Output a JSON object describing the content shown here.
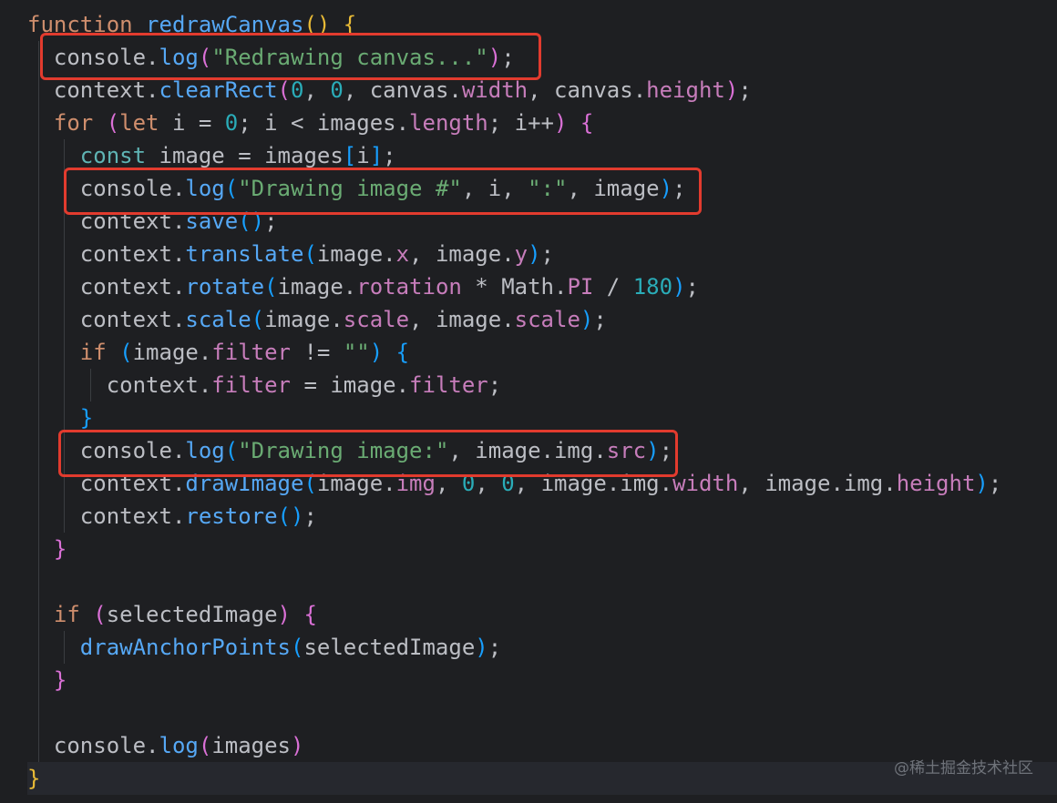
{
  "colors": {
    "background": "#1e1f22",
    "highlight_border": "#e23b2e",
    "keyword": "#cf8e6d",
    "function": "#56a8f5",
    "string": "#6aab73",
    "number": "#2aacb8",
    "property": "#c77dbb"
  },
  "editor": {
    "lines": [
      [
        {
          "t": "function ",
          "c": "c-kw"
        },
        {
          "t": "redrawCanvas",
          "c": "c-fn"
        },
        {
          "t": "() ",
          "c": "c-b1"
        },
        {
          "t": "{",
          "c": "c-b1"
        }
      ],
      [
        {
          "t": "  console.",
          "c": "c-def"
        },
        {
          "t": "log",
          "c": "c-fn"
        },
        {
          "t": "(",
          "c": "c-b2"
        },
        {
          "t": "\"Redrawing canvas...\"",
          "c": "c-str"
        },
        {
          "t": ")",
          "c": "c-b2"
        },
        {
          "t": ";",
          "c": "c-def"
        }
      ],
      [
        {
          "t": "  context.",
          "c": "c-def"
        },
        {
          "t": "clearRect",
          "c": "c-fn"
        },
        {
          "t": "(",
          "c": "c-b2"
        },
        {
          "t": "0",
          "c": "c-num"
        },
        {
          "t": ", ",
          "c": "c-def"
        },
        {
          "t": "0",
          "c": "c-num"
        },
        {
          "t": ", canvas.",
          "c": "c-def"
        },
        {
          "t": "width",
          "c": "c-prop"
        },
        {
          "t": ", canvas.",
          "c": "c-def"
        },
        {
          "t": "height",
          "c": "c-prop"
        },
        {
          "t": ")",
          "c": "c-b2"
        },
        {
          "t": ";",
          "c": "c-def"
        }
      ],
      [
        {
          "t": "  for ",
          "c": "c-kw"
        },
        {
          "t": "(",
          "c": "c-b2"
        },
        {
          "t": "let ",
          "c": "c-kw"
        },
        {
          "t": "i = ",
          "c": "c-def"
        },
        {
          "t": "0",
          "c": "c-num"
        },
        {
          "t": "; i < images.",
          "c": "c-def"
        },
        {
          "t": "length",
          "c": "c-prop"
        },
        {
          "t": "; i++",
          "c": "c-def"
        },
        {
          "t": ") ",
          "c": "c-b2"
        },
        {
          "t": "{",
          "c": "c-b2"
        }
      ],
      [
        {
          "t": "    const ",
          "c": "c-kw2"
        },
        {
          "t": "image = images",
          "c": "c-def"
        },
        {
          "t": "[",
          "c": "c-b3"
        },
        {
          "t": "i",
          "c": "c-def"
        },
        {
          "t": "]",
          "c": "c-b3"
        },
        {
          "t": ";",
          "c": "c-def"
        }
      ],
      [
        {
          "t": "    console.",
          "c": "c-def"
        },
        {
          "t": "log",
          "c": "c-fn"
        },
        {
          "t": "(",
          "c": "c-b3"
        },
        {
          "t": "\"Drawing image #\"",
          "c": "c-str"
        },
        {
          "t": ", i, ",
          "c": "c-def"
        },
        {
          "t": "\":\"",
          "c": "c-str"
        },
        {
          "t": ", image",
          "c": "c-def"
        },
        {
          "t": ")",
          "c": "c-b3"
        },
        {
          "t": ";",
          "c": "c-def"
        }
      ],
      [
        {
          "t": "    context.",
          "c": "c-def"
        },
        {
          "t": "save",
          "c": "c-fn"
        },
        {
          "t": "()",
          "c": "c-b3"
        },
        {
          "t": ";",
          "c": "c-def"
        }
      ],
      [
        {
          "t": "    context.",
          "c": "c-def"
        },
        {
          "t": "translate",
          "c": "c-fn"
        },
        {
          "t": "(",
          "c": "c-b3"
        },
        {
          "t": "image.",
          "c": "c-def"
        },
        {
          "t": "x",
          "c": "c-prop"
        },
        {
          "t": ", image.",
          "c": "c-def"
        },
        {
          "t": "y",
          "c": "c-prop"
        },
        {
          "t": ")",
          "c": "c-b3"
        },
        {
          "t": ";",
          "c": "c-def"
        }
      ],
      [
        {
          "t": "    context.",
          "c": "c-def"
        },
        {
          "t": "rotate",
          "c": "c-fn"
        },
        {
          "t": "(",
          "c": "c-b3"
        },
        {
          "t": "image.",
          "c": "c-def"
        },
        {
          "t": "rotation",
          "c": "c-prop"
        },
        {
          "t": " * Math.",
          "c": "c-def"
        },
        {
          "t": "PI",
          "c": "c-prop"
        },
        {
          "t": " / ",
          "c": "c-def"
        },
        {
          "t": "180",
          "c": "c-num"
        },
        {
          "t": ")",
          "c": "c-b3"
        },
        {
          "t": ";",
          "c": "c-def"
        }
      ],
      [
        {
          "t": "    context.",
          "c": "c-def"
        },
        {
          "t": "scale",
          "c": "c-fn"
        },
        {
          "t": "(",
          "c": "c-b3"
        },
        {
          "t": "image.",
          "c": "c-def"
        },
        {
          "t": "scale",
          "c": "c-prop"
        },
        {
          "t": ", image.",
          "c": "c-def"
        },
        {
          "t": "scale",
          "c": "c-prop"
        },
        {
          "t": ")",
          "c": "c-b3"
        },
        {
          "t": ";",
          "c": "c-def"
        }
      ],
      [
        {
          "t": "    if ",
          "c": "c-kw"
        },
        {
          "t": "(",
          "c": "c-b3"
        },
        {
          "t": "image.",
          "c": "c-def"
        },
        {
          "t": "filter",
          "c": "c-prop"
        },
        {
          "t": " != ",
          "c": "c-def"
        },
        {
          "t": "\"\"",
          "c": "c-str"
        },
        {
          "t": ") ",
          "c": "c-b3"
        },
        {
          "t": "{",
          "c": "c-b3"
        }
      ],
      [
        {
          "t": "      context.",
          "c": "c-def"
        },
        {
          "t": "filter",
          "c": "c-prop"
        },
        {
          "t": " = image.",
          "c": "c-def"
        },
        {
          "t": "filter",
          "c": "c-prop"
        },
        {
          "t": ";",
          "c": "c-def"
        }
      ],
      [
        {
          "t": "    }",
          "c": "c-b3"
        }
      ],
      [
        {
          "t": "    console.",
          "c": "c-def"
        },
        {
          "t": "log",
          "c": "c-fn"
        },
        {
          "t": "(",
          "c": "c-b3"
        },
        {
          "t": "\"Drawing image:\"",
          "c": "c-str"
        },
        {
          "t": ", image.img.",
          "c": "c-def"
        },
        {
          "t": "src",
          "c": "c-prop"
        },
        {
          "t": ")",
          "c": "c-b3"
        },
        {
          "t": ";",
          "c": "c-def"
        }
      ],
      [
        {
          "t": "    context.",
          "c": "c-def"
        },
        {
          "t": "drawImage",
          "c": "c-fn"
        },
        {
          "t": "(",
          "c": "c-b3"
        },
        {
          "t": "image.",
          "c": "c-def"
        },
        {
          "t": "img",
          "c": "c-prop"
        },
        {
          "t": ", ",
          "c": "c-def"
        },
        {
          "t": "0",
          "c": "c-num"
        },
        {
          "t": ", ",
          "c": "c-def"
        },
        {
          "t": "0",
          "c": "c-num"
        },
        {
          "t": ", image.img.",
          "c": "c-def"
        },
        {
          "t": "width",
          "c": "c-prop"
        },
        {
          "t": ", image.img.",
          "c": "c-def"
        },
        {
          "t": "height",
          "c": "c-prop"
        },
        {
          "t": ")",
          "c": "c-b3"
        },
        {
          "t": ";",
          "c": "c-def"
        }
      ],
      [
        {
          "t": "    context.",
          "c": "c-def"
        },
        {
          "t": "restore",
          "c": "c-fn"
        },
        {
          "t": "()",
          "c": "c-b3"
        },
        {
          "t": ";",
          "c": "c-def"
        }
      ],
      [
        {
          "t": "  }",
          "c": "c-b2"
        }
      ],
      [],
      [
        {
          "t": "  if ",
          "c": "c-kw"
        },
        {
          "t": "(",
          "c": "c-b2"
        },
        {
          "t": "selectedImage",
          "c": "c-def"
        },
        {
          "t": ") ",
          "c": "c-b2"
        },
        {
          "t": "{",
          "c": "c-b2"
        }
      ],
      [
        {
          "t": "    drawAnchorPoints",
          "c": "c-fn"
        },
        {
          "t": "(",
          "c": "c-b3"
        },
        {
          "t": "selectedImage",
          "c": "c-def"
        },
        {
          "t": ")",
          "c": "c-b3"
        },
        {
          "t": ";",
          "c": "c-def"
        }
      ],
      [
        {
          "t": "  }",
          "c": "c-b2"
        }
      ],
      [],
      [
        {
          "t": "  console.",
          "c": "c-def"
        },
        {
          "t": "log",
          "c": "c-fn"
        },
        {
          "t": "(",
          "c": "c-b2"
        },
        {
          "t": "images",
          "c": "c-def"
        },
        {
          "t": ")",
          "c": "c-b2"
        }
      ],
      [
        {
          "t": "}",
          "c": "c-b1"
        }
      ]
    ]
  },
  "watermark": "@稀土掘金技术社区"
}
